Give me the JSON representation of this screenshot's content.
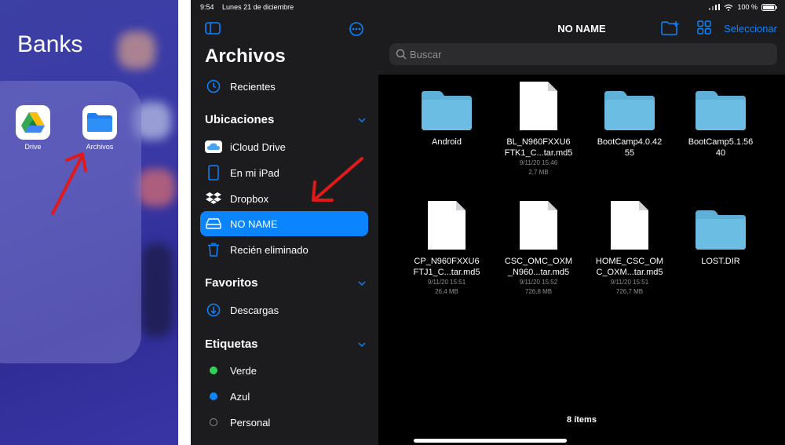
{
  "home": {
    "folder_title": "Banks",
    "apps": [
      {
        "label": "Drive",
        "icon": "google-drive-icon"
      },
      {
        "label": "Archivos",
        "icon": "files-folder-icon"
      }
    ]
  },
  "sidebar": {
    "status": {
      "time": "9:54",
      "date": "Lunes 21 de diciembre"
    },
    "title": "Archivos",
    "recents": {
      "label": "Recientes",
      "icon": "clock-icon"
    },
    "locations": {
      "header": "Ubicaciones",
      "items": [
        {
          "label": "iCloud Drive",
          "icon": "icloud-icon"
        },
        {
          "label": "En mi iPad",
          "icon": "ipad-icon"
        },
        {
          "label": "Dropbox",
          "icon": "dropbox-icon"
        },
        {
          "label": "NO NAME",
          "icon": "drive-icon",
          "selected": true
        },
        {
          "label": "Recién eliminado",
          "icon": "trash-icon"
        }
      ]
    },
    "favorites": {
      "header": "Favoritos",
      "items": [
        {
          "label": "Descargas",
          "icon": "download-icon"
        }
      ]
    },
    "tags": {
      "header": "Etiquetas",
      "items": [
        {
          "label": "Verde",
          "color": "#30d158"
        },
        {
          "label": "Azul",
          "color": "#0a84ff"
        },
        {
          "label": "Personal",
          "color": "transparent"
        }
      ]
    }
  },
  "content": {
    "status": {
      "battery": "100 %"
    },
    "title": "NO NAME",
    "select_label": "Seleccionar",
    "search_placeholder": "Buscar",
    "items": [
      {
        "type": "folder",
        "name_line1": "Android",
        "name_line2": "",
        "date": "",
        "size": ""
      },
      {
        "type": "file",
        "name_line1": "BL_N960FXXU6",
        "name_line2": "FTK1_C...tar.md5",
        "date": "9/11/20 15:46",
        "size": "2,7 MB"
      },
      {
        "type": "folder",
        "name_line1": "BootCamp4.0.42",
        "name_line2": "55",
        "date": "",
        "size": ""
      },
      {
        "type": "folder",
        "name_line1": "BootCamp5.1.56",
        "name_line2": "40",
        "date": "",
        "size": ""
      },
      {
        "type": "file",
        "name_line1": "CP_N960FXXU6",
        "name_line2": "FTJ1_C...tar.md5",
        "date": "9/11/20 15:51",
        "size": "26,4 MB"
      },
      {
        "type": "file",
        "name_line1": "CSC_OMC_OXM",
        "name_line2": "_N960...tar.md5",
        "date": "9/11/20 15:52",
        "size": "726,8 MB"
      },
      {
        "type": "file",
        "name_line1": "HOME_CSC_OM",
        "name_line2": "C_OXM...tar.md5",
        "date": "9/11/20 15:51",
        "size": "726,7 MB"
      },
      {
        "type": "folder",
        "name_line1": "LOST.DIR",
        "name_line2": "",
        "date": "",
        "size": ""
      }
    ],
    "count": "8 ítems"
  },
  "colors": {
    "accent": "#0a84ff",
    "folder": "#5fb0d8",
    "annotation_arrow": "#e0191b"
  }
}
